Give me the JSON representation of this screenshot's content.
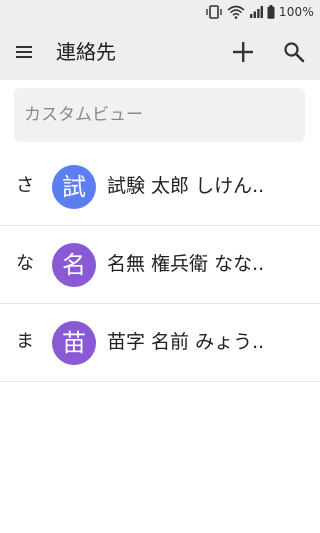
{
  "status_bar": {
    "battery_text": "100%"
  },
  "app_bar": {
    "title": "連絡先"
  },
  "search": {
    "placeholder": "カスタムビュー"
  },
  "contacts": [
    {
      "index": "さ",
      "avatar_char": "試",
      "avatar_color": "#5b7ff0",
      "name": "試験 太郎 しけん.."
    },
    {
      "index": "な",
      "avatar_char": "名",
      "avatar_color": "#8a5ad6",
      "name": "名無 権兵衛 なな.."
    },
    {
      "index": "ま",
      "avatar_char": "苗",
      "avatar_color": "#8a5ad6",
      "name": "苗字 名前 みょう.."
    }
  ]
}
